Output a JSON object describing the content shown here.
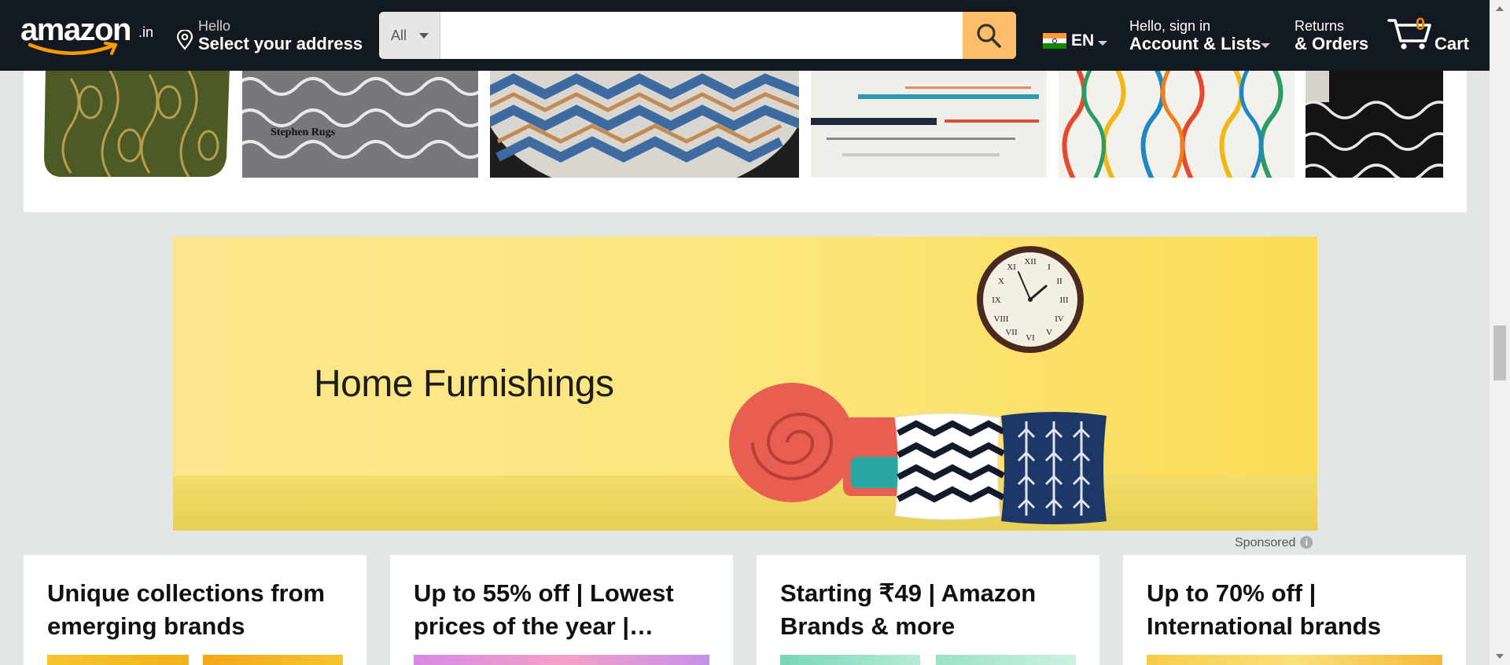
{
  "nav": {
    "logo_text": "amazon",
    "logo_tld": ".in",
    "address": {
      "line1": "Hello",
      "line2": "Select your address"
    },
    "search": {
      "category": "All",
      "placeholder": ""
    },
    "language": "EN",
    "account": {
      "line1": "Hello, sign in",
      "line2": "Account & Lists"
    },
    "orders": {
      "line1": "Returns",
      "line2": "& Orders"
    },
    "cart": {
      "count": "0",
      "label": "Cart"
    },
    "colors": {
      "bar": "#131921",
      "search_button": "#febd69",
      "cart_count": "#f08804"
    }
  },
  "carousel": {
    "items": [
      {
        "name": "green-brocade-cushion-cover-thumb"
      },
      {
        "name": "grey-trellis-rug-thumb",
        "caption": "Stephen Rugs"
      },
      {
        "name": "round-geometric-rug-thumb"
      },
      {
        "name": "striped-shaggy-rug-thumb"
      },
      {
        "name": "colorful-moroccan-rug-thumb"
      },
      {
        "name": "black-trellis-rug-thumb"
      }
    ]
  },
  "banner": {
    "headline": "Home Furnishings",
    "sponsored": "Sponsored",
    "info": "i"
  },
  "cards": [
    {
      "title": "Unique collections from emerging brands"
    },
    {
      "title": "Up to 55% off | Lowest prices of the year |…"
    },
    {
      "title": "Starting ₹49 | Amazon Brands & more"
    },
    {
      "title": "Up to 70% off | International brands"
    }
  ]
}
